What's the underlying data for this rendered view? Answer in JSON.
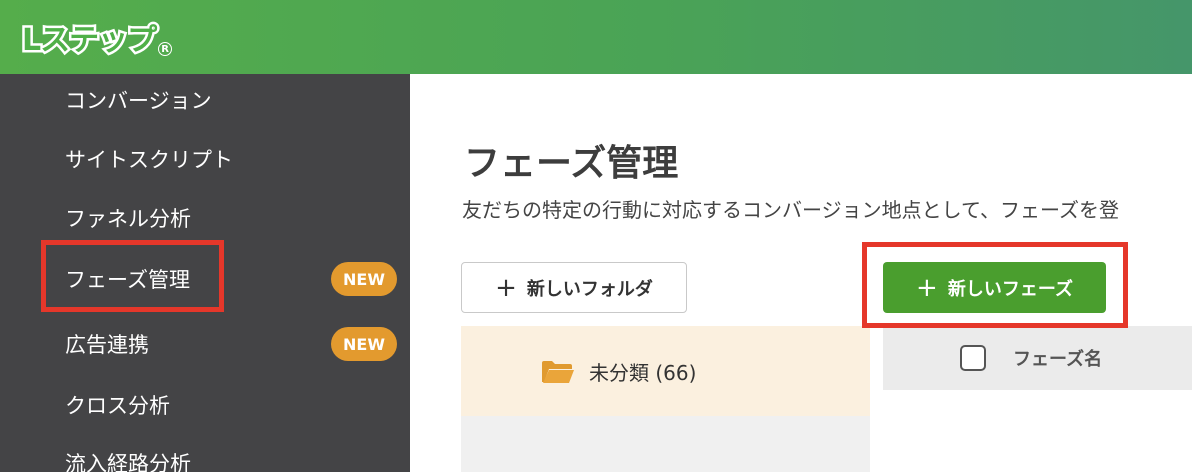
{
  "header": {
    "logo_text": "Lステップ",
    "logo_reg": "R",
    "brand_colors": {
      "gradient_start": "#55ad4b",
      "gradient_end": "#45966a"
    }
  },
  "sidebar": {
    "items": [
      {
        "label": "コンバージョン"
      },
      {
        "label": "サイトスクリプト"
      },
      {
        "label": "ファネル分析"
      },
      {
        "label": "フェーズ管理",
        "badge": "NEW",
        "highlighted": true
      },
      {
        "label": "広告連携",
        "badge": "NEW"
      },
      {
        "label": "クロス分析"
      },
      {
        "label": "流入経路分析"
      }
    ]
  },
  "main": {
    "title": "フェーズ管理",
    "description": "友だちの特定の行動に対応するコンバージョン地点として、フェーズを登",
    "new_folder_button": {
      "icon": "plus-icon",
      "label": "新しいフォルダ"
    },
    "new_phase_button": {
      "icon": "plus-icon",
      "label": "新しいフェーズ",
      "color": "#4a9e2e"
    },
    "folders": [
      {
        "icon": "folder-icon",
        "label": "未分類 (66)",
        "selected": true
      }
    ],
    "table": {
      "columns": [
        {
          "label": "フェーズ名"
        }
      ]
    }
  },
  "annotations": {
    "highlight_color": "#e5372a"
  }
}
